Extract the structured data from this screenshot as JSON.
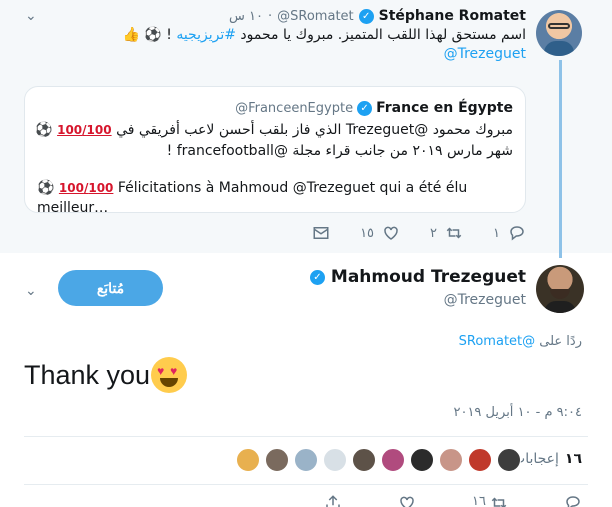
{
  "parent_tweet": {
    "name": "Stéphane Romatet",
    "handle": "@SRomatet",
    "time": "١٠ س",
    "text_main": "اسم مستحق لهذا اللقب المتميز.  مبروك يا محمود",
    "hashtag": "#تريزيجيه",
    "text_tail": "!",
    "mention": "@Trezeguet",
    "quote": {
      "name": "France en Égypte",
      "handle": "@FranceenEgypte",
      "line1": "مبروك محمود @Trezeguet الذي فاز بلقب أحسن لاعب أفريقي في",
      "line2": "شهر مارس ٢٠١٩ من جانب قراء مجلة @francefootball !",
      "line3": "Félicitations à Mahmoud @Trezeguet qui a été élu meilleur…",
      "hundred_label": "100"
    },
    "actions": {
      "reply_count": "١",
      "retweet_count": "٢",
      "like_count": "١٥"
    }
  },
  "main_tweet": {
    "name": "Mahmoud Trezeguet",
    "handle": "@Trezeguet",
    "follow_label": "مُتابَع",
    "reply_prefix": "ردًا على",
    "reply_to": "@SRomatet",
    "text": "Thank you",
    "timestamp": "٩:٠٤ م - ١٠ أبريل ٢٠١٩",
    "likes_label": "إعجابات",
    "likes_count": "١٦",
    "bottom_retweet_count": "١٦"
  },
  "colors": {
    "accent": "#1da1f2",
    "parent_bg": "#f5f8fa",
    "follow_bg": "#4ba7e6",
    "thread_line": "#8ec2e8"
  },
  "liker_colors": [
    "#e8b04f",
    "#7a6a5e",
    "#9ab3c8",
    "#d8e0e6",
    "#5d5248",
    "#b04b7e",
    "#2b2b2b",
    "#c89588",
    "#c0392b",
    "#3d3d3d"
  ]
}
